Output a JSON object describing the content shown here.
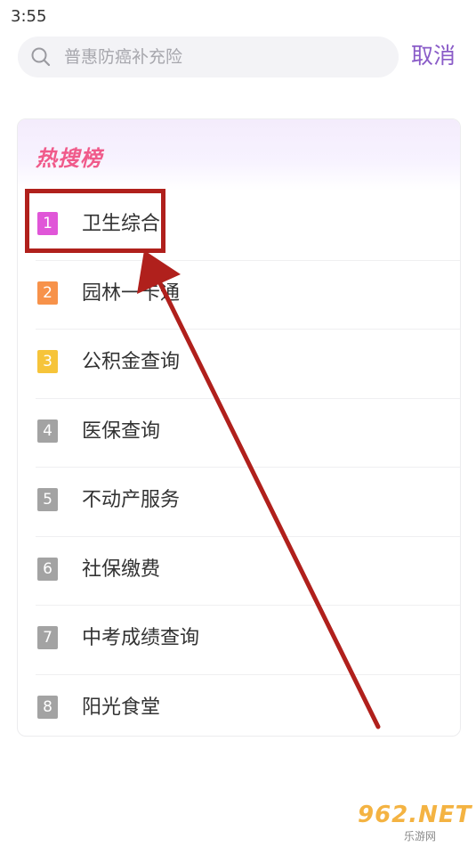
{
  "status_bar": {
    "time": "3:55"
  },
  "search": {
    "placeholder": "普惠防癌补充险",
    "cancel_label": "取消",
    "icon": "search-icon"
  },
  "hot_list": {
    "title": "热搜榜",
    "items": [
      {
        "rank": "1",
        "label": "卫生综合",
        "badge_color": "#e056d8"
      },
      {
        "rank": "2",
        "label": "园林一卡通",
        "badge_color": "#f7924a"
      },
      {
        "rank": "3",
        "label": "公积金查询",
        "badge_color": "#f6c43a"
      },
      {
        "rank": "4",
        "label": "医保查询",
        "badge_color": "#a3a3a3"
      },
      {
        "rank": "5",
        "label": "不动产服务",
        "badge_color": "#a3a3a3"
      },
      {
        "rank": "6",
        "label": "社保缴费",
        "badge_color": "#a3a3a3"
      },
      {
        "rank": "7",
        "label": "中考成绩查询",
        "badge_color": "#a3a3a3"
      },
      {
        "rank": "8",
        "label": "阳光食堂",
        "badge_color": "#a3a3a3"
      }
    ]
  },
  "colors": {
    "accent": "#8a5cc8",
    "title": "#f05a8a",
    "annotation": "#b0201c"
  },
  "watermark": {
    "main": "962.NET",
    "sub": "乐游网"
  }
}
